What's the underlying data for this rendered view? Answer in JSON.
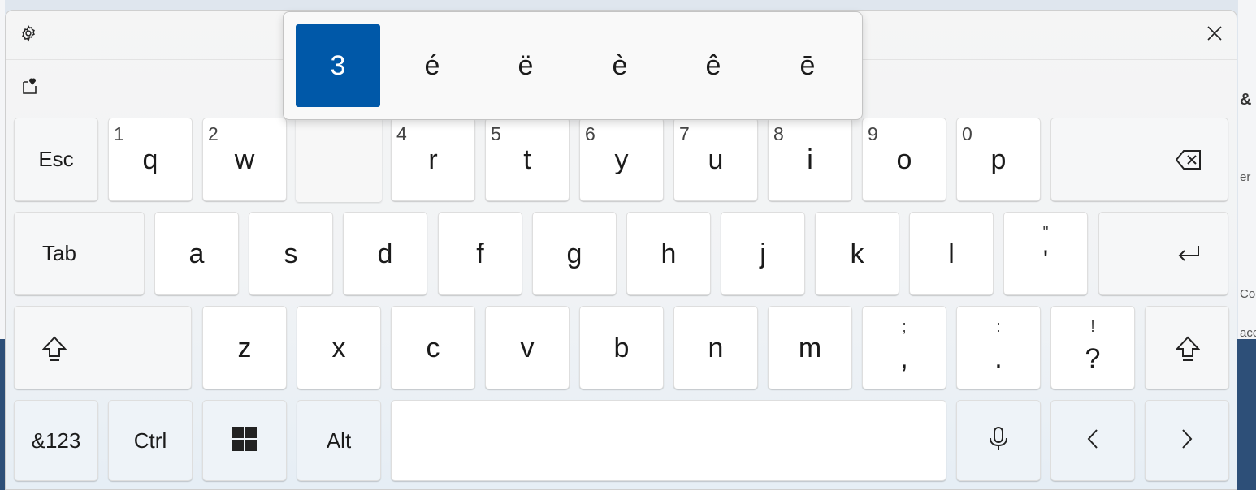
{
  "background": {
    "right_texts": [
      "&",
      "er",
      "Con",
      "ace"
    ]
  },
  "toolbar": {
    "settings_icon": "gear-icon",
    "close_icon": "close-icon",
    "emoji_icon": "emoji-panel-icon"
  },
  "popup": {
    "selected": "3",
    "alternates": [
      "3",
      "é",
      "ë",
      "è",
      "ê",
      "ē"
    ]
  },
  "rows": {
    "row1": {
      "esc": "Esc",
      "keys": [
        {
          "hint": "1",
          "main": "q"
        },
        {
          "hint": "2",
          "main": "w"
        },
        {
          "hint": "4",
          "main": "r"
        },
        {
          "hint": "5",
          "main": "t"
        },
        {
          "hint": "6",
          "main": "y"
        },
        {
          "hint": "7",
          "main": "u"
        },
        {
          "hint": "8",
          "main": "i"
        },
        {
          "hint": "9",
          "main": "o"
        },
        {
          "hint": "0",
          "main": "p"
        }
      ],
      "backspace_icon": "backspace-icon"
    },
    "row2": {
      "tab": "Tab",
      "keys": [
        "a",
        "s",
        "d",
        "f",
        "g",
        "h",
        "j",
        "k",
        "l"
      ],
      "quote": {
        "top": "\"",
        "main": "'"
      },
      "enter_icon": "enter-icon"
    },
    "row3": {
      "shift_icon": "shift-icon",
      "keys": [
        "z",
        "x",
        "c",
        "v",
        "b",
        "n",
        "m"
      ],
      "comma": {
        "top": ";",
        "main": ","
      },
      "period": {
        "top": ":",
        "main": "."
      },
      "question": {
        "top": "!",
        "main": "?"
      }
    },
    "row4": {
      "symbols": "&123",
      "ctrl": "Ctrl",
      "windows_icon": "windows-icon",
      "alt": "Alt",
      "mic_icon": "microphone-icon",
      "left_icon": "chevron-left-icon",
      "right_icon": "chevron-right-icon"
    }
  },
  "colors": {
    "accent": "#0058a8",
    "key": "#ffffff",
    "panel": "#f3f3f3"
  }
}
